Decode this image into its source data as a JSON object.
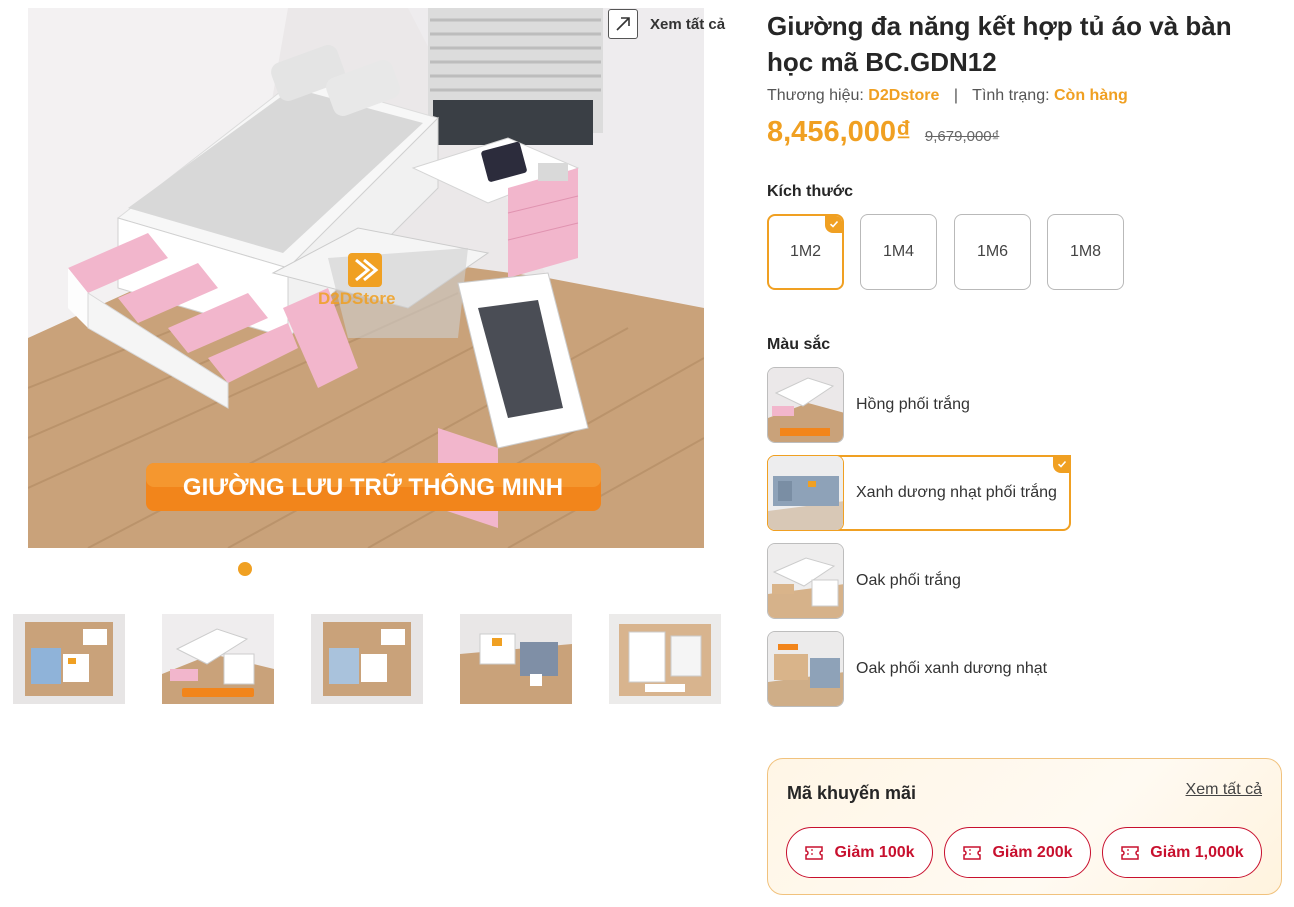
{
  "gallery": {
    "view_all_label": "Xem tất cả",
    "banner_text": "GIƯỜNG LƯU TRỮ THÔNG MINH",
    "brand_watermark": "D2DStore",
    "thumbnails": [
      {
        "name": "thumb-1",
        "active": false
      },
      {
        "name": "thumb-2",
        "active": true
      },
      {
        "name": "thumb-3",
        "active": false
      },
      {
        "name": "thumb-4",
        "active": false
      },
      {
        "name": "thumb-5",
        "active": false
      }
    ]
  },
  "product": {
    "title": "Giường đa năng kết hợp tủ áo và bàn học mã BC.GDN12",
    "brand_label": "Thương hiệu:",
    "brand_value": "D2Dstore",
    "separator": "|",
    "status_label": "Tình trạng:",
    "status_value": "Còn hàng",
    "price": "8,456,000₫",
    "old_price": "9,679,000₫"
  },
  "sizes": {
    "label": "Kích thước",
    "options": [
      "1M2",
      "1M4",
      "1M6",
      "1M8"
    ],
    "selected": "1M2"
  },
  "colors": {
    "label": "Màu sắc",
    "options": [
      "Hồng phối trắng",
      "Xanh dương nhạt phối trắng",
      "Oak phối trắng",
      "Oak phối xanh dương nhạt"
    ],
    "selected": "Xanh dương nhạt phối trắng"
  },
  "promo": {
    "title": "Mã khuyến mãi",
    "view_all": "Xem tất cả",
    "coupons": [
      "Giảm 100k",
      "Giảm 200k",
      "Giảm 1,000k"
    ]
  },
  "theme": {
    "accent": "#f0a022",
    "coupon": "#c8102e",
    "pink": "#f2b6cc",
    "wood": "#c9a27a"
  }
}
